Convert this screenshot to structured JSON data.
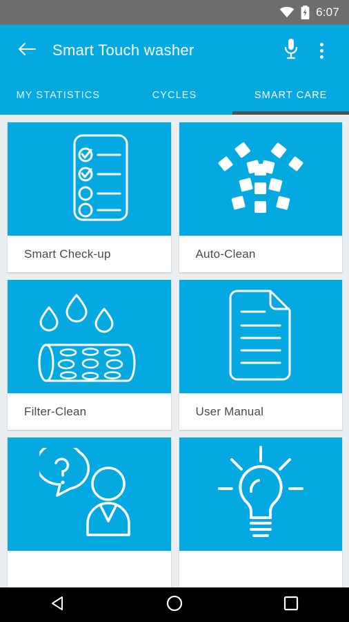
{
  "status_bar": {
    "time": "6:07",
    "wifi_icon": "wifi-icon",
    "battery_icon": "battery-charging-icon",
    "background_color": "#6e6e6e"
  },
  "app_bar": {
    "back_icon": "back-arrow-icon",
    "title": "Smart Touch washer",
    "mic_icon": "microphone-icon",
    "overflow_icon": "overflow-menu-icon",
    "background_color": "#03a9e0"
  },
  "tabs": {
    "items": [
      {
        "label": "MY STATISTICS",
        "active": false
      },
      {
        "label": "CYCLES",
        "active": false
      },
      {
        "label": "SMART CARE",
        "active": true
      }
    ],
    "indicator_color": "#4e5256"
  },
  "grid": {
    "accent_color": "#03a9e0",
    "label_color": "#4a4a4a",
    "cards": [
      {
        "label": "Smart Check-up",
        "icon": "checklist-icon"
      },
      {
        "label": "Auto-Clean",
        "icon": "spray-sparkle-icon"
      },
      {
        "label": "Filter-Clean",
        "icon": "water-drops-drum-icon"
      },
      {
        "label": "User Manual",
        "icon": "document-page-icon"
      },
      {
        "label": "",
        "icon": "question-support-icon"
      },
      {
        "label": "",
        "icon": "lightbulb-icon"
      }
    ]
  },
  "nav_bar": {
    "back_icon": "nav-back-triangle-icon",
    "home_icon": "nav-home-circle-icon",
    "recents_icon": "nav-recents-square-icon"
  }
}
